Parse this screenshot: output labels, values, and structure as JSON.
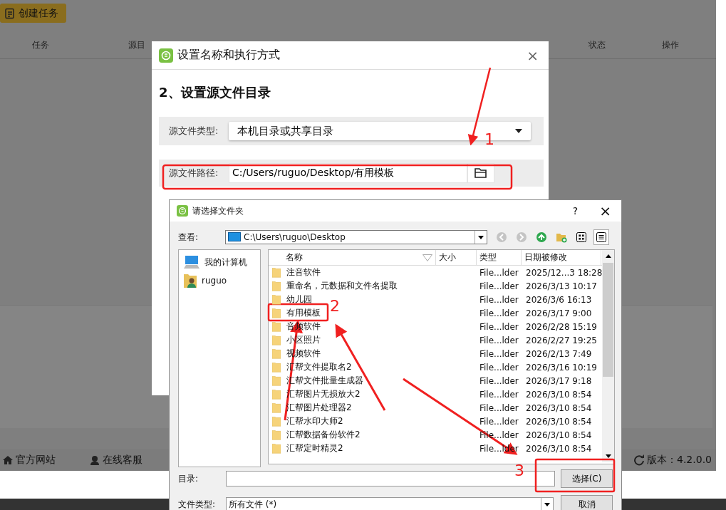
{
  "app": {
    "create_button": "创建任务",
    "columns": [
      {
        "label": "任务"
      },
      {
        "label": "源目"
      },
      {
        "label": "状态"
      },
      {
        "label": "操作"
      }
    ],
    "footer": [
      {
        "kind": "home",
        "label": "官方网站"
      },
      {
        "kind": "support",
        "label": "在线客服"
      }
    ],
    "version": {
      "label": "版本：4.2.0.0"
    }
  },
  "dialog": {
    "title": "设置名称和执行方式",
    "close": "×",
    "heading": "2、设置源文件目录",
    "type_label": "源文件类型:",
    "type_value": "本机目录或共享目录",
    "path_label": "源文件路径:",
    "path_value": "C:/Users/ruguo/Desktop/有用模板"
  },
  "picker": {
    "title": "请选择文件夹",
    "help": "?",
    "close": "×",
    "look_label": "查看:",
    "look_value": "C:\\Users\\ruguo\\Desktop",
    "nav_buttons": [
      {
        "kind": "back",
        "disabled": true
      },
      {
        "kind": "forward",
        "disabled": true
      },
      {
        "kind": "up",
        "disabled": false
      },
      {
        "kind": "new-folder",
        "disabled": false
      }
    ],
    "view_buttons": [
      {
        "kind": "grid",
        "selected": false
      },
      {
        "kind": "detail",
        "selected": true
      }
    ],
    "places": [
      {
        "kind": "computer",
        "label": "我的计算机",
        "selected": false
      },
      {
        "kind": "user",
        "label": "ruguo",
        "selected": false
      }
    ],
    "columns": [
      {
        "label": "名称"
      },
      {
        "label": "大小"
      },
      {
        "label": "类型"
      },
      {
        "label": "日期被修改"
      }
    ],
    "rows": [
      {
        "name": "注音软件",
        "type": "File...lder",
        "modified": "2025/12...3 18:28",
        "selected": false
      },
      {
        "name": "重命名，元数据和文件名提取",
        "type": "File...lder",
        "modified": "2026/3/13 10:17",
        "selected": false
      },
      {
        "name": "幼儿园",
        "type": "File...lder",
        "modified": "2026/3/6 16:13",
        "selected": false
      },
      {
        "name": "有用模板",
        "type": "File...lder",
        "modified": "2026/3/17 9:00",
        "selected": false
      },
      {
        "name": "音频软件",
        "type": "File...lder",
        "modified": "2026/2/28 15:19",
        "selected": false
      },
      {
        "name": "小区照片",
        "type": "File...lder",
        "modified": "2026/2/27 19:25",
        "selected": false
      },
      {
        "name": "视频软件",
        "type": "File...lder",
        "modified": "2026/2/13 7:49",
        "selected": false
      },
      {
        "name": "汇帮文件提取名2",
        "type": "File...lder",
        "modified": "2026/3/16 10:19",
        "selected": false
      },
      {
        "name": "汇帮文件批量生成器",
        "type": "File...lder",
        "modified": "2026/3/17 9:18",
        "selected": false
      },
      {
        "name": "汇帮图片无损放大2",
        "type": "File...lder",
        "modified": "2026/3/10 8:54",
        "selected": false
      },
      {
        "name": "汇帮图片处理器2",
        "type": "File...lder",
        "modified": "2026/3/10 8:54",
        "selected": false
      },
      {
        "name": "汇帮水印大师2",
        "type": "File...lder",
        "modified": "2026/3/10 8:54",
        "selected": false
      },
      {
        "name": "汇帮数据备份软件2",
        "type": "File...lder",
        "modified": "2026/3/10 8:54",
        "selected": false
      },
      {
        "name": "汇帮定时精灵2",
        "type": "File...lder",
        "modified": "2026/3/10 8:54",
        "selected": false
      }
    ],
    "dir_label": "目录:",
    "choose_button": "选择(C)",
    "filetype_label": "文件类型:",
    "filetype_value": "所有文件 (*)",
    "cancel_button": "取消"
  },
  "annotations": [
    {
      "label": "1"
    },
    {
      "label": "2"
    },
    {
      "label": "3"
    }
  ]
}
